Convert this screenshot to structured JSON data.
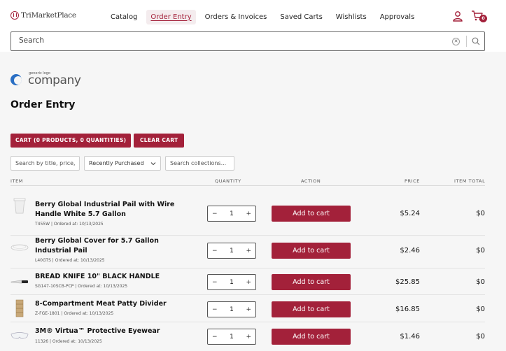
{
  "header": {
    "brand": "TriMarketPlace",
    "nav": [
      "Catalog",
      "Order Entry",
      "Orders & Invoices",
      "Saved Carts",
      "Wishlists",
      "Approvals"
    ],
    "cart_count": "0"
  },
  "search": {
    "placeholder": "Search"
  },
  "company_logo": {
    "small": "generic logo",
    "big": "company"
  },
  "page": {
    "title": "Order Entry",
    "cart_button": "CART (0 PRODUCTS, 0 QUANTITIES)",
    "clear_button": "CLEAR CART"
  },
  "filters": {
    "search_placeholder": "Search by title, price, ty",
    "sort_value": "Recently Purchased",
    "collections_placeholder": "Search collections..."
  },
  "columns": {
    "item": "ITEM",
    "quantity": "QUANTITY",
    "action": "ACTION",
    "price": "PRICE",
    "total": "ITEM TOTAL"
  },
  "add_label": "Add to cart",
  "rows": [
    {
      "name": "Berry Global Industrial Pail with Wire Handle White 5.7 Gallon",
      "meta": "T455W | Ordered at: 10/13/2025",
      "qty": "1",
      "price": "$5.24",
      "total": "$0",
      "thumb": "pail-icon"
    },
    {
      "name": "Berry Global Cover for 5.7 Gallon Industrial Pail",
      "meta": "L40GTS | Ordered at: 10/13/2025",
      "qty": "1",
      "price": "$2.46",
      "total": "$0",
      "thumb": "lid-icon"
    },
    {
      "name": "BREAD KNIFE 10\" BLACK HANDLE",
      "meta": "SG147-10SCB-PCP | Ordered at: 10/13/2025",
      "qty": "1",
      "price": "$25.85",
      "total": "$0",
      "thumb": "knife-icon"
    },
    {
      "name": "8-Compartment Meat Patty Divider",
      "meta": "Z-FGE-1801 | Ordered at: 10/13/2025",
      "qty": "1",
      "price": "$16.85",
      "total": "$0",
      "thumb": "divider-icon"
    },
    {
      "name": "3M® Virtua™ Protective Eyewear",
      "meta": "11326 | Ordered at: 10/13/2025",
      "qty": "1",
      "price": "$1.46",
      "total": "$0",
      "thumb": "eyewear-icon"
    }
  ],
  "colors": {
    "accent": "#a3213a",
    "panel": "#f6f6f6"
  }
}
